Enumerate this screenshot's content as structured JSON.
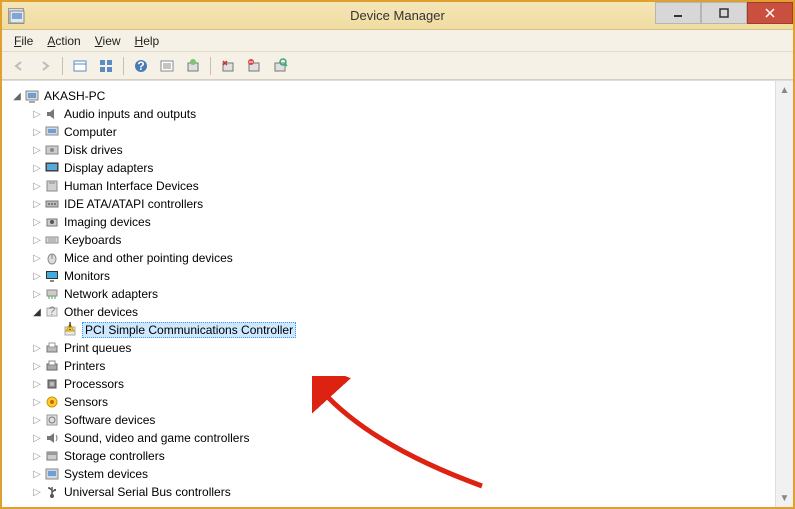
{
  "window": {
    "title": "Device Manager"
  },
  "menu": {
    "file": "File",
    "action": "Action",
    "view": "View",
    "help": "Help"
  },
  "tree": {
    "root": {
      "label": "AKASH-PC",
      "expanded": true
    },
    "categories": [
      {
        "label": "Audio inputs and outputs",
        "icon": "audio-icon",
        "expanded": false
      },
      {
        "label": "Computer",
        "icon": "computer-icon",
        "expanded": false
      },
      {
        "label": "Disk drives",
        "icon": "disk-icon",
        "expanded": false
      },
      {
        "label": "Display adapters",
        "icon": "display-icon",
        "expanded": false
      },
      {
        "label": "Human Interface Devices",
        "icon": "hid-icon",
        "expanded": false
      },
      {
        "label": "IDE ATA/ATAPI controllers",
        "icon": "ide-icon",
        "expanded": false
      },
      {
        "label": "Imaging devices",
        "icon": "imaging-icon",
        "expanded": false
      },
      {
        "label": "Keyboards",
        "icon": "keyboard-icon",
        "expanded": false
      },
      {
        "label": "Mice and other pointing devices",
        "icon": "mouse-icon",
        "expanded": false
      },
      {
        "label": "Monitors",
        "icon": "monitor-icon",
        "expanded": false
      },
      {
        "label": "Network adapters",
        "icon": "network-icon",
        "expanded": false
      },
      {
        "label": "Other devices",
        "icon": "other-icon",
        "expanded": true,
        "children": [
          {
            "label": "PCI Simple Communications Controller",
            "icon": "warning-device-icon",
            "selected": true
          }
        ]
      },
      {
        "label": "Print queues",
        "icon": "print-icon",
        "expanded": false
      },
      {
        "label": "Printers",
        "icon": "printer-icon",
        "expanded": false
      },
      {
        "label": "Processors",
        "icon": "cpu-icon",
        "expanded": false
      },
      {
        "label": "Sensors",
        "icon": "sensor-icon",
        "expanded": false
      },
      {
        "label": "Software devices",
        "icon": "software-icon",
        "expanded": false
      },
      {
        "label": "Sound, video and game controllers",
        "icon": "sound-icon",
        "expanded": false
      },
      {
        "label": "Storage controllers",
        "icon": "storage-icon",
        "expanded": false
      },
      {
        "label": "System devices",
        "icon": "system-icon",
        "expanded": false
      },
      {
        "label": "Universal Serial Bus controllers",
        "icon": "usb-icon",
        "expanded": false
      }
    ]
  }
}
